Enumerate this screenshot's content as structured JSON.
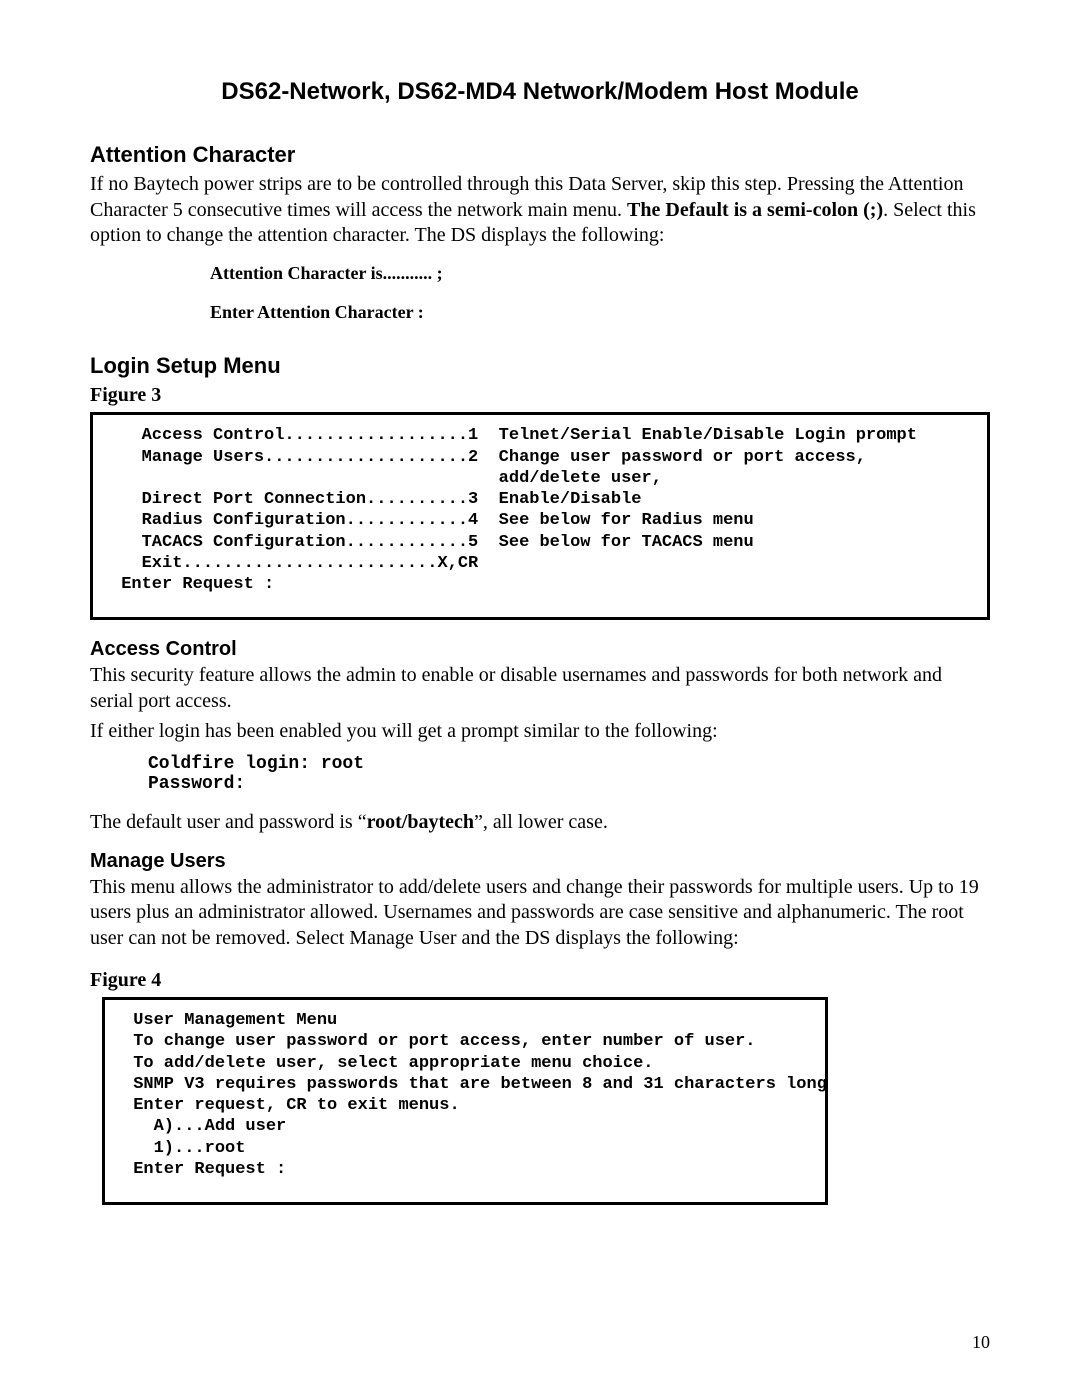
{
  "header_title": "DS62-Network, DS62-MD4 Network/Modem Host Module",
  "attention": {
    "heading": "Attention Character",
    "para_pre": "If no Baytech power strips are to be controlled through this Data Server, skip this step. Pressing the Attention Character 5 consecutive times will access the network main menu. ",
    "para_bold": "The Default is a semi-colon (;)",
    "para_post": ". Select this option to change the attention character. The DS displays the following:",
    "line1": "Attention Character is...........  ;",
    "line2": "Enter Attention Character :"
  },
  "login_setup": {
    "heading": "Login Setup Menu",
    "figure_label": "Figure 3",
    "terminal": "   Access Control..................1  Telnet/Serial Enable/Disable Login prompt\n   Manage Users....................2  Change user password or port access,\n                                      add/delete user,\n   Direct Port Connection..........3  Enable/Disable\n   Radius Configuration............4  See below for Radius menu\n   TACACS Configuration............5  See below for TACACS menu\n   Exit.........................X,CR\n Enter Request :"
  },
  "access_control": {
    "heading": "Access Control",
    "para1": "This security feature allows the admin to enable or disable usernames and passwords for both network and serial port access.",
    "para2": "If either login has been enabled you will get a prompt similar to the following:",
    "login_block": "Coldfire login: root\nPassword:",
    "para3_pre": "The default user and password is “",
    "para3_bold": "root/baytech",
    "para3_post": "”, all lower case."
  },
  "manage_users": {
    "heading": "Manage Users",
    "para": "This menu allows the administrator to add/delete users and change their passwords for multiple users. Up to 19 users plus an administrator allowed. Usernames and passwords are case sensitive and alphanumeric. The root user can not be removed. Select Manage User and the DS displays the following:",
    "figure_label": "Figure 4",
    "terminal": " User Management Menu\n To change user password or port access, enter number of user.\n To add/delete user, select appropriate menu choice.\n SNMP V3 requires passwords that are between 8 and 31 characters long\n Enter request, CR to exit menus.\n   A)...Add user\n   1)...root\n Enter Request :"
  },
  "page_number": "10"
}
